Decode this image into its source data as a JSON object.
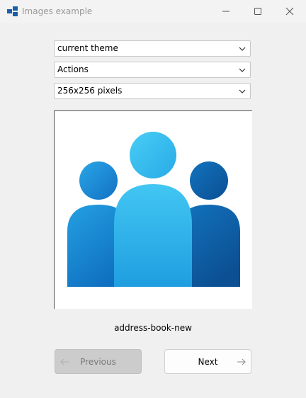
{
  "window": {
    "title": "Images example"
  },
  "controls": {
    "theme_select": {
      "value": "current theme"
    },
    "context_select": {
      "value": "Actions"
    },
    "size_select": {
      "value": "256x256 pixels"
    }
  },
  "preview": {
    "icon": "address-book-new-icon",
    "caption": "address-book-new"
  },
  "buttons": {
    "previous": {
      "label": "Previous",
      "enabled": false,
      "icon": "arrow-left-icon"
    },
    "next": {
      "label": "Next",
      "enabled": true,
      "icon": "arrow-right-icon"
    }
  },
  "colors": {
    "accent_light": "#40c4f0",
    "accent_mid": "#1a8fd8",
    "accent_dark": "#0f5ea3"
  }
}
